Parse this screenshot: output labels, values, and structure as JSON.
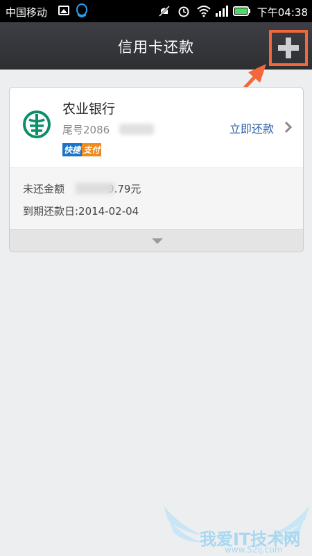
{
  "status_bar": {
    "carrier": "中国移动",
    "time": "下午04:38"
  },
  "header": {
    "title": "信用卡还款",
    "add_icon": "plus-icon"
  },
  "card": {
    "bank_name": "农业银行",
    "card_tail": "尾号2086",
    "quick_pay_badge": [
      "快捷",
      "支付"
    ],
    "repay_button": "立即还款",
    "due_amount_label": "未还金额",
    "due_amount_tail": "9.79元",
    "due_date": "到期还款日:2014-02-04"
  },
  "watermark": {
    "text": "我爱IT技术网",
    "sub": "www.52ij.com"
  },
  "colors": {
    "accent_orange": "#f2683b",
    "link_blue": "#2b5fa8",
    "bank_green": "#0a8f6a"
  }
}
